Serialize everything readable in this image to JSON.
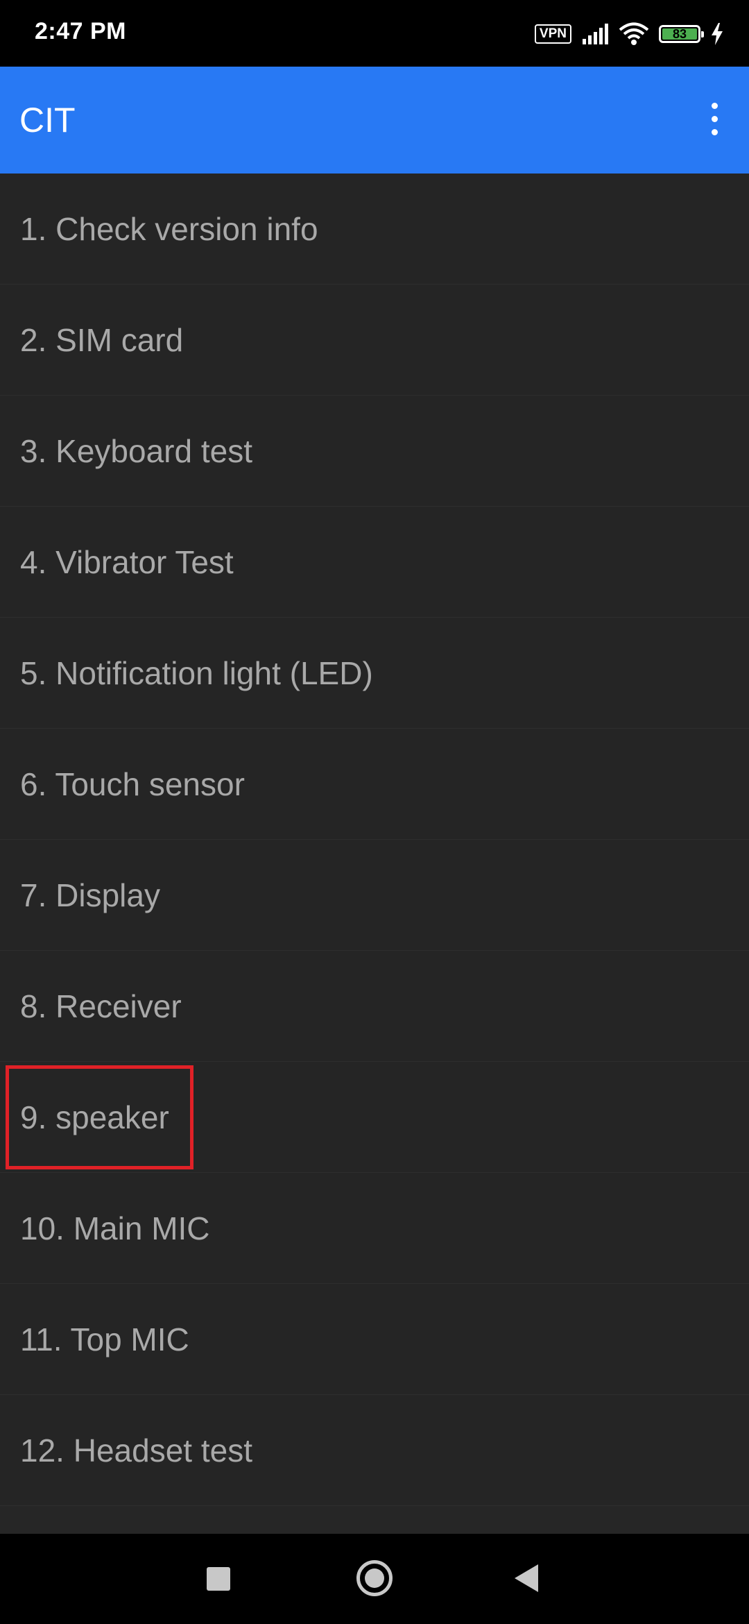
{
  "status_bar": {
    "time": "2:47 PM",
    "vpn_label": "VPN",
    "battery_level": "83",
    "icons": [
      "vpn-icon",
      "signal-icon",
      "wifi-icon",
      "battery-icon",
      "charging-icon"
    ]
  },
  "app_bar": {
    "title": "CIT",
    "menu_icon": "overflow-menu-icon"
  },
  "test_list": {
    "items": [
      {
        "label": "1. Check version info"
      },
      {
        "label": "2. SIM card"
      },
      {
        "label": "3. Keyboard test"
      },
      {
        "label": "4. Vibrator Test"
      },
      {
        "label": "5. Notification light (LED)"
      },
      {
        "label": "6. Touch sensor"
      },
      {
        "label": "7. Display"
      },
      {
        "label": "8. Receiver"
      },
      {
        "label": "9. speaker"
      },
      {
        "label": "10. Main MIC"
      },
      {
        "label": "11. Top MIC"
      },
      {
        "label": "12. Headset test"
      }
    ],
    "highlighted_item": "9. speaker"
  },
  "nav_bar": {
    "buttons": [
      "recents-icon",
      "home-icon",
      "back-icon"
    ]
  },
  "colors": {
    "app_bar": "#2879f4",
    "list_background": "#252525",
    "list_text": "#a9a9a9",
    "highlight": "#e02127",
    "battery_fill": "#4caf50"
  }
}
